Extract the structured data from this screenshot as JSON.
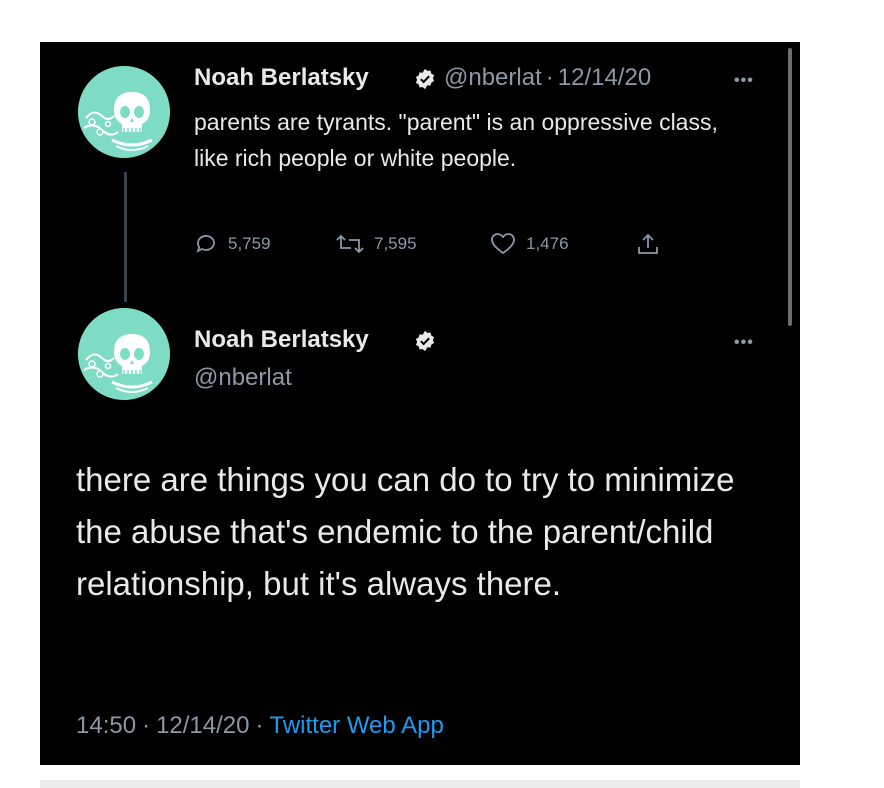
{
  "tweet1": {
    "display_name": "Noah Berlatsky",
    "handle": "@nberlat",
    "separator": "·",
    "date": "12/14/20",
    "more": "•••",
    "text": "parents are tyrants. \"parent\" is an oppressive class, like rich people or white people.",
    "replies": "5,759",
    "retweets": "7,595",
    "likes": "1,476"
  },
  "tweet2": {
    "display_name": "Noah Berlatsky",
    "handle": "@nberlat",
    "more": "•••",
    "text": "there are things you can do to try to minimize the abuse that's endemic to the parent/child relationship, but it's always there.",
    "time": "14:50",
    "separator": "·",
    "date": "12/14/20",
    "separator2": "·",
    "source": "Twitter Web App"
  },
  "colors": {
    "background": "#000000",
    "text": "#e7e9ea",
    "muted": "#8b98a5",
    "link": "#1d9bf0",
    "avatar": "#7fdcc4"
  },
  "icons": [
    "skull-avatar-icon",
    "verified-badge-icon",
    "reply-icon",
    "retweet-icon",
    "like-icon",
    "share-icon",
    "more-icon"
  ]
}
